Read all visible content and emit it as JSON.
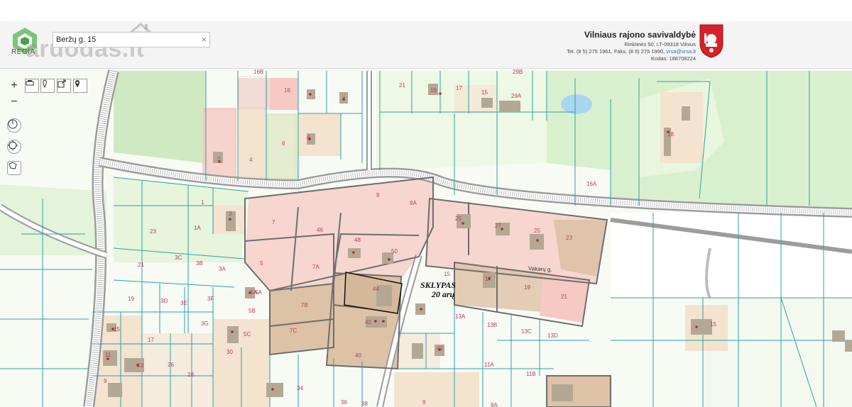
{
  "header": {
    "logo_text": "REGIA",
    "watermark_text": "aruodas.lt",
    "search": {
      "value": "Beržų g. 15",
      "clear_glyph": "×"
    },
    "municipality": {
      "name": "Vilniaus rajono savivaldybė",
      "address": "Rinktinės 50, LT-09318 Vilnius",
      "phone_prefix": "Tel. (8 5) 275 1961, Faks. (8 5) 275 1990,",
      "email": "vrsa@vrsa.lt",
      "code": "Kodas: 188708224"
    }
  },
  "toolbar": {
    "zoom_in": "+",
    "zoom_out": "−",
    "icons": [
      "print-icon",
      "measure-pin-icon",
      "share-icon",
      "location-pin-icon",
      "compass-icon",
      "target-icon",
      "polygon-select-icon"
    ]
  },
  "map": {
    "street_name": "Vakarų g.",
    "annotation_line1": "SKLYPAS",
    "annotation_line2": "20 arų",
    "parcel_labels": [
      "16B",
      "16",
      "4",
      "29B",
      "21",
      "19",
      "17",
      "15",
      "29A",
      "18",
      "2",
      "4",
      "6",
      "6",
      "9",
      "9A",
      "16A",
      "1",
      "23",
      "1A",
      "3",
      "7",
      "46",
      "48",
      "50",
      "25",
      "27",
      "25",
      "23",
      "3C",
      "3B",
      "3A",
      "21",
      "5",
      "7A",
      "15",
      "17",
      "19",
      "21",
      "44",
      "SA",
      "5A",
      "5B",
      "19",
      "3D",
      "3E",
      "3F",
      "3G",
      "7B",
      "42",
      "13A",
      "13B",
      "13C",
      "13D",
      "15",
      "15",
      "7C",
      "5C",
      "17",
      "30",
      "40",
      "41",
      "11",
      "13",
      "26",
      "28",
      "11A",
      "11B",
      "9",
      "34",
      "36",
      "38",
      "9",
      "9A"
    ]
  },
  "colors": {
    "parcel_outline": "#2aa3a3",
    "parcel_pink": "#f6c9c3",
    "parcel_tan": "#ddc2a6",
    "green_area": "#d6efc8",
    "highlight_outline": "#6e6e6e",
    "road": "#9c9c9c"
  }
}
